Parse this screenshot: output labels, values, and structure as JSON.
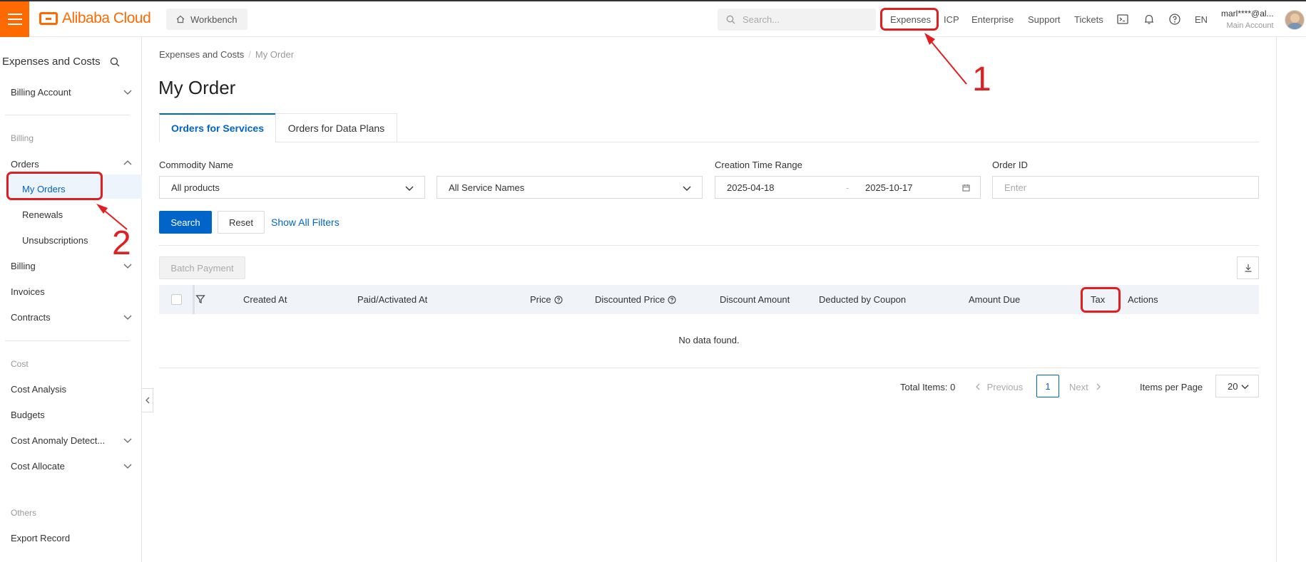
{
  "header": {
    "brand": "Alibaba Cloud",
    "workbench": "Workbench",
    "search_placeholder": "Search...",
    "nav": [
      "Expenses",
      "ICP",
      "Enterprise",
      "Support",
      "Tickets"
    ],
    "language": "EN",
    "user_name": "marl****@al...",
    "user_role": "Main Account"
  },
  "sidebar": {
    "title": "Expenses and Costs",
    "billing_account": "Billing Account",
    "group_billing": "Billing",
    "orders": "Orders",
    "my_orders": "My Orders",
    "renewals": "Renewals",
    "unsubscriptions": "Unsubscriptions",
    "billing": "Billing",
    "invoices": "Invoices",
    "contracts": "Contracts",
    "group_cost": "Cost",
    "cost_analysis": "Cost Analysis",
    "budgets": "Budgets",
    "cost_anomaly": "Cost Anomaly Detect...",
    "cost_allocate": "Cost Allocate",
    "group_others": "Others",
    "export_record": "Export Record"
  },
  "breadcrumb": {
    "root": "Expenses and Costs",
    "current": "My Order"
  },
  "page_title": "My Order",
  "tabs": [
    "Orders for Services",
    "Orders for Data Plans"
  ],
  "filters": {
    "commodity_label": "Commodity Name",
    "commodity_value": "All products",
    "service_value": "All Service Names",
    "time_label": "Creation Time Range",
    "time_start": "2025-04-18",
    "time_sep": "-",
    "time_end": "2025-10-17",
    "order_id_label": "Order ID",
    "order_id_placeholder": "Enter"
  },
  "buttons": {
    "search": "Search",
    "reset": "Reset",
    "show_filters": "Show All Filters",
    "batch_payment": "Batch Payment"
  },
  "table": {
    "columns": [
      "Created At",
      "Paid/Activated At",
      "Price",
      "Discounted Price",
      "Discount Amount",
      "Deducted by Coupon",
      "Amount Due",
      "Tax",
      "Actions"
    ],
    "empty": "No data found."
  },
  "pagination": {
    "total": "Total Items: 0",
    "previous": "Previous",
    "page": "1",
    "next": "Next",
    "per_page_label": "Items per Page",
    "per_page_value": "20"
  },
  "annotations": [
    "1",
    "2"
  ],
  "colors": {
    "brand": "#ff6a00",
    "primary": "#0064c8",
    "annotation": "#e02020"
  }
}
